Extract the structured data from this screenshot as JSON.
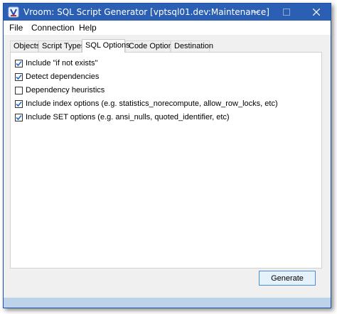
{
  "window": {
    "title": "Vroom: SQL Script Generator [vptsql01.dev:Maintenance]"
  },
  "menu": {
    "items": [
      "File",
      "Connection",
      "Help"
    ]
  },
  "tabs": [
    {
      "label": "Objects",
      "active": false
    },
    {
      "label": "Script Types",
      "active": false
    },
    {
      "label": "SQL Options",
      "active": true
    },
    {
      "label": "Code Options",
      "active": false
    },
    {
      "label": "Destination",
      "active": false
    }
  ],
  "options": [
    {
      "label": "Include \"if not exists\"",
      "checked": true
    },
    {
      "label": "Detect dependencies",
      "checked": true
    },
    {
      "label": "Dependency heuristics",
      "checked": false
    },
    {
      "label": "Include index options (e.g. statistics_norecompute, allow_row_locks, etc)",
      "checked": true
    },
    {
      "label": "Include SET options (e.g. ansi_nulls, quoted_identifier, etc)",
      "checked": true
    }
  ],
  "actions": {
    "generate_label": "Generate"
  },
  "colors": {
    "titlebar": "#2b5fb4",
    "accent_button_border": "#4b8fd6",
    "footer_bar": "#bcd3ea"
  }
}
